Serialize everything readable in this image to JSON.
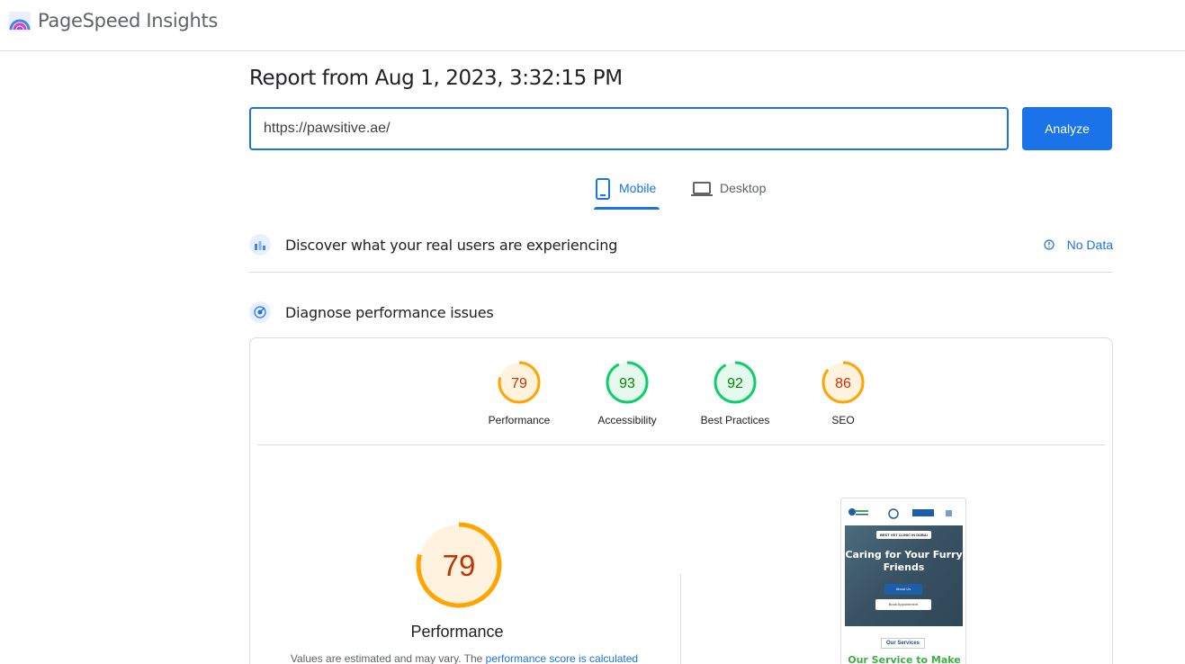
{
  "app": {
    "brand": "PageSpeed Insights"
  },
  "report": {
    "title": "Report from Aug 1, 2023, 3:32:15 PM"
  },
  "search": {
    "url_value": "https://pawsitive.ae/",
    "analyze_label": "Analyze"
  },
  "tabs": [
    {
      "label": "Mobile",
      "active": true
    },
    {
      "label": "Desktop",
      "active": false
    }
  ],
  "field_data": {
    "title": "Discover what your real users are experiencing",
    "status": "No Data"
  },
  "lab_data": {
    "title": "Diagnose performance issues",
    "scores": [
      {
        "label": "Performance",
        "score": 79,
        "rating": "average"
      },
      {
        "label": "Accessibility",
        "score": 93,
        "rating": "pass"
      },
      {
        "label": "Best Practices",
        "score": 92,
        "rating": "pass"
      },
      {
        "label": "SEO",
        "score": 86,
        "rating": "average"
      }
    ],
    "main_score": {
      "label": "Performance",
      "score": "79"
    },
    "note_prefix": "Values are estimated and may vary. The ",
    "note_link": "performance score is calculated"
  },
  "preview": {
    "badge": "BEST VET CLINIC IN DUBAI",
    "heading": "Caring for Your Furry Friends",
    "btn1": "About Us",
    "btn2": "Book Appointment",
    "nav_btn": "Book Now",
    "services_label": "Our Services",
    "services_title": "Our Service to Make"
  },
  "colors": {
    "accent": "#1a73e8",
    "average": "#ffa400",
    "average_text": "#c33300",
    "average_bg": "#fff3e0",
    "pass": "#0cce6b",
    "pass_text": "#008800",
    "pass_bg": "#e6f9ee"
  }
}
